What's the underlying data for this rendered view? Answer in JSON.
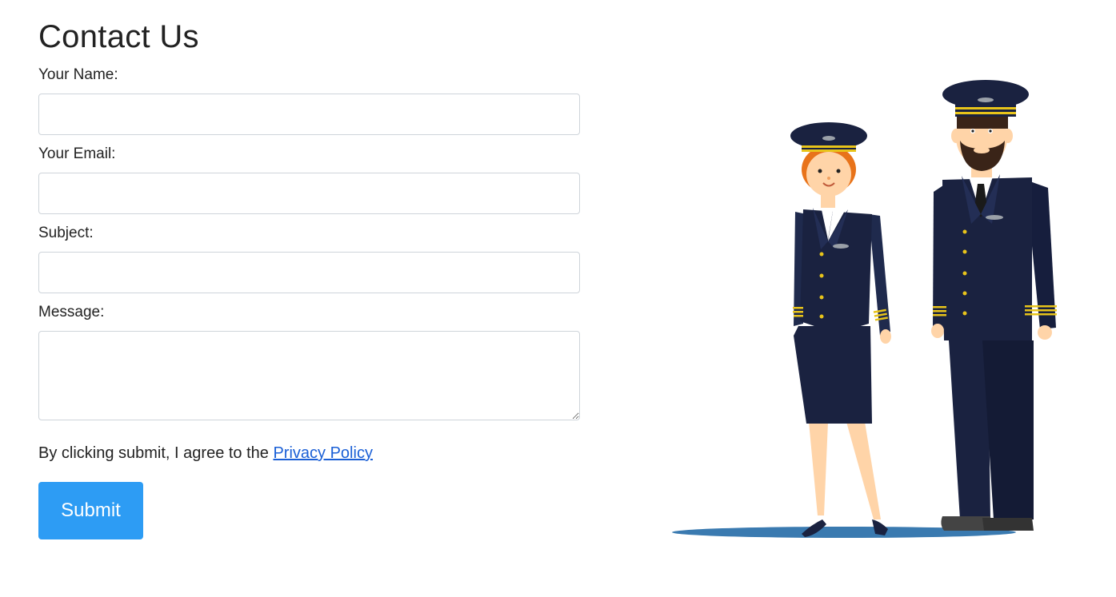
{
  "page": {
    "title": "Contact Us"
  },
  "form": {
    "name_label": "Your Name:",
    "name_value": "",
    "email_label": "Your Email:",
    "email_value": "",
    "subject_label": "Subject:",
    "subject_value": "",
    "message_label": "Message:",
    "message_value": "",
    "consent_text": "By clicking submit, I agree to the ",
    "privacy_link": "Privacy Policy",
    "submit_label": "Submit"
  },
  "illustration": {
    "subject": "pilots-illustration",
    "colors": {
      "uniform": "#1a2240",
      "stripes": "#e8c41a",
      "shadow": "#3a7ab0",
      "skin": "#ffd4a8"
    }
  },
  "colors": {
    "accent": "#2d9cf4",
    "link": "#1a5fd6",
    "border": "#ced4da"
  }
}
